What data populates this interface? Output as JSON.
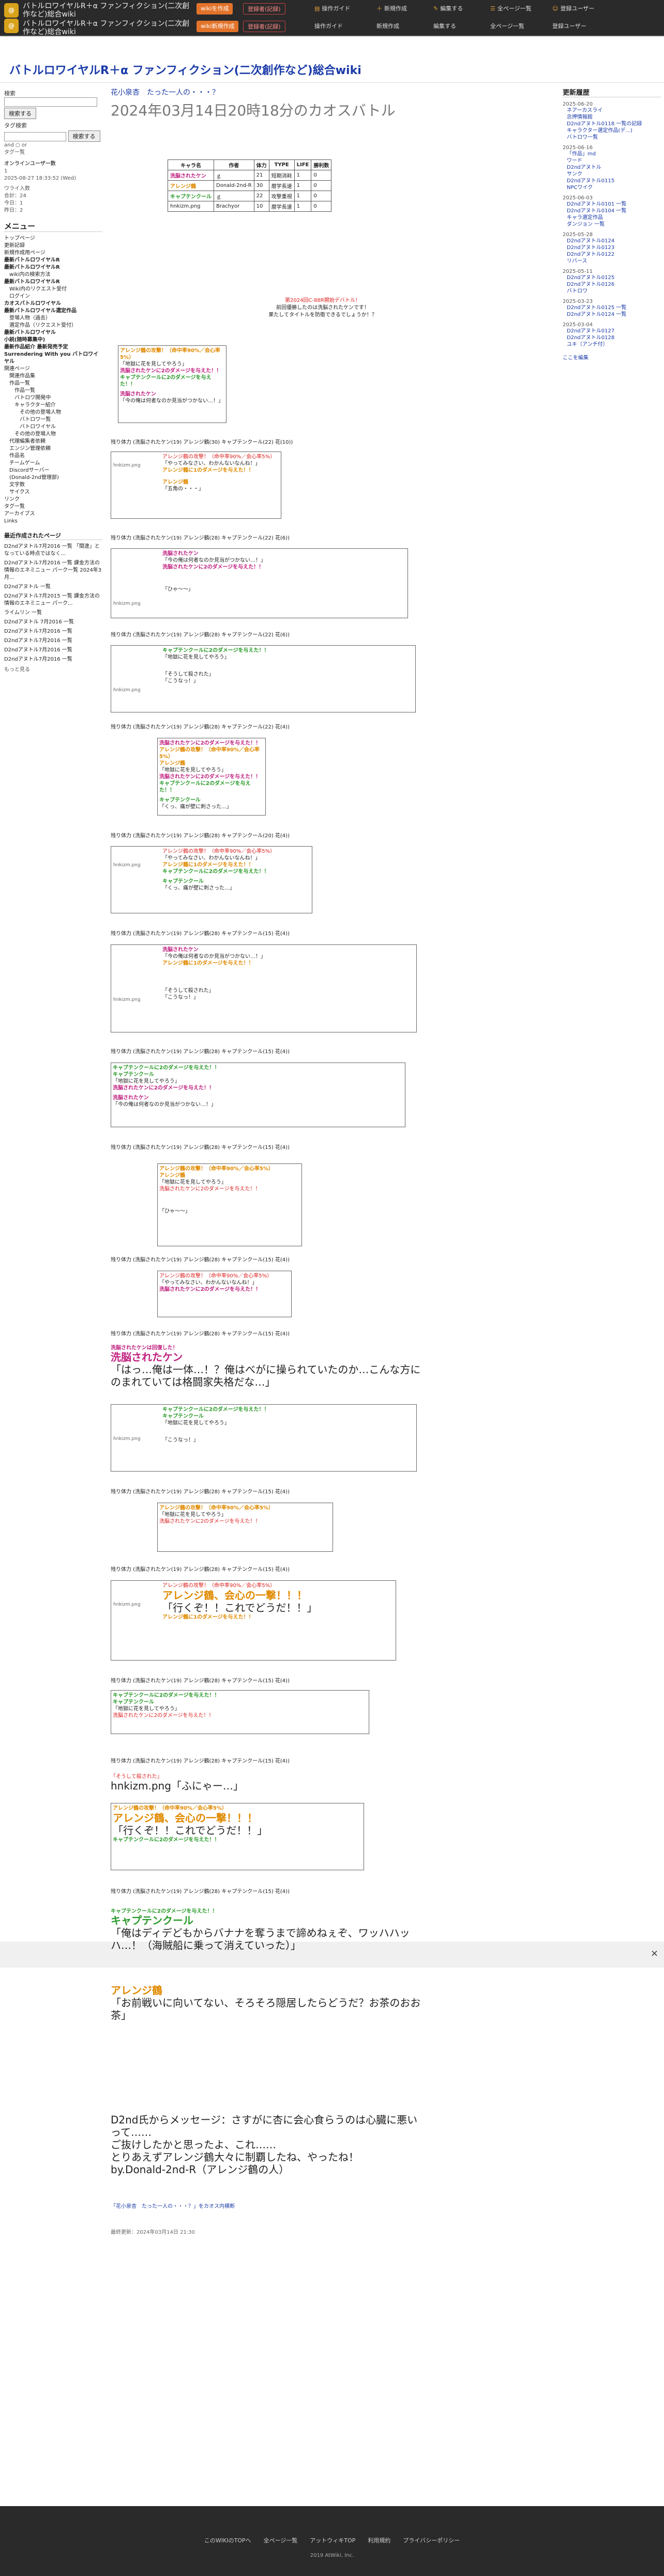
{
  "topbar": {
    "wiki_title_1": "バトルロワイヤルR＋α ファンフィクション(二次創作など)総合wiki",
    "wiki_title_2": "バトルロワイヤルR＋α ファンフィクション(二次創作など)総合wiki",
    "tabs": [
      "wikiを作成",
      "wiki新規作成",
      "登録者(記録)",
      "操作ガイド",
      "新規作成",
      "編集する",
      "全ページ一覧",
      "登録ユーザー"
    ]
  },
  "header": {
    "site_title": "バトルロワイヤルR＋α ファンフィクション(二次創作など)総合wiki"
  },
  "left": {
    "search_label": "検索",
    "search_button": "検索する",
    "tag_label": "タグ検索",
    "tag_button": "検索する",
    "and_or": "and ○ or",
    "tag_list": "タグ一覧",
    "online_title": "オンラインユーザー数",
    "online_count": "1",
    "date": "2025-08-27 18:33:52 (Wed)",
    "stats": [
      "ワライ入数",
      "合計：24",
      "今日：1",
      "昨日：2"
    ],
    "menu_title": "メニュー",
    "menu": [
      {
        "t": "トップページ",
        "c": ""
      },
      {
        "t": "更新記録",
        "c": ""
      },
      {
        "t": "新規作成用ページ",
        "c": ""
      },
      {
        "t": "最新バトルロワイヤルR",
        "c": "b"
      },
      {
        "t": "最新バトルロワイヤルR",
        "c": "b"
      },
      {
        "t": "wiki内の検索方法",
        "c": "i1"
      },
      {
        "t": "最新バトルロワイヤルR",
        "c": "b"
      },
      {
        "t": "Wiki内のリクエスト受付",
        "c": "i1"
      },
      {
        "t": "ログイン",
        "c": "i1"
      },
      {
        "t": "カオスバトルロワイヤル",
        "c": "b"
      },
      {
        "t": "最新バトルロワイヤル選定作品",
        "c": "b"
      },
      {
        "t": "登場人物（過去）",
        "c": "i1"
      },
      {
        "t": "選定作品（リクエスト受付）",
        "c": "i1"
      },
      {
        "t": "最新バトルロワイヤル",
        "c": "b"
      },
      {
        "t": "小説(随時募集中)",
        "c": "b"
      },
      {
        "t": "最新作品紹介 最新発売予定",
        "c": "b"
      },
      {
        "t": "Surrendering With you バトロワイヤル",
        "c": "b"
      },
      {
        "t": "関連ページ",
        "c": ""
      },
      {
        "t": "関連作品集",
        "c": "i1"
      },
      {
        "t": "作品一覧",
        "c": "i1"
      },
      {
        "t": "作品一覧",
        "c": "i2"
      },
      {
        "t": "バトロワ開発中",
        "c": "i2"
      },
      {
        "t": "キャラクター紹介",
        "c": "i2"
      },
      {
        "t": "その他の登場人物",
        "c": "i3"
      },
      {
        "t": "バトロワ一覧",
        "c": "i3"
      },
      {
        "t": "バトロワイヤル",
        "c": "i3"
      },
      {
        "t": "その他の登場人物",
        "c": "i2"
      },
      {
        "t": "代理編集者依頼",
        "c": "i1"
      },
      {
        "t": "エンジン管理依頼",
        "c": "i1"
      },
      {
        "t": "作品名",
        "c": "i1"
      },
      {
        "t": "チームゲーム",
        "c": "i1"
      },
      {
        "t": "Discordサーバー",
        "c": "i1"
      },
      {
        "t": "(Donald-2nd管理部)",
        "c": "i1"
      },
      {
        "t": "文字数",
        "c": "i1"
      },
      {
        "t": "サイクス",
        "c": "i1"
      },
      {
        "t": "リンク",
        "c": ""
      },
      {
        "t": "タグ一覧",
        "c": ""
      },
      {
        "t": "アーカイブス",
        "c": ""
      },
      {
        "t": "Links",
        "c": ""
      }
    ],
    "recent_title": "最近作成されたページ",
    "recent": [
      "D2ndアヌトル7月2016 一覧 「間違」となっている時点ではなく...",
      "D2ndアヌトル7月2016 一覧 課金方法の情報のエネミニュー パーク一覧 2024年3月...",
      "D2ndアヌトル 一覧",
      "D2ndアヌトル7月2015 一覧 課金方法の情報のエネミニュー パーク...",
      "ライムリン 一覧",
      "D2ndアヌトル 7月2016 一覧",
      "D2ndアヌトル7月2016 一覧",
      "D2ndアヌトル7月2016 一覧",
      "D2ndアヌトル7月2016 一覧",
      "D2ndアヌトル7月2016 一覧"
    ],
    "more": "もっと見る"
  },
  "right": {
    "title": "更新履歴",
    "groups": [
      {
        "day": "2025-06-20",
        "items": [
          "ネアーカスライ",
          "念押情報館",
          "D2ndアヌトル0118 一覧の記録",
          "キャラクター選定作品(デ...)",
          "バトロワ一覧"
        ]
      },
      {
        "day": "2025-06-16",
        "items": [
          "「作品」md",
          "ワード",
          "D2ndアヌトル",
          "サンク",
          "D2ndアヌトル0115",
          "NPCワイク"
        ]
      },
      {
        "day": "2025-06-03",
        "items": [
          "D2ndアヌトル0101 一覧",
          "D2ndアヌトル0104 一覧",
          "キャラ選定作品",
          "ダンジョン 一覧"
        ]
      },
      {
        "day": "2025-05-28",
        "items": [
          "D2ndアヌトル0124",
          "D2ndアヌトル0123",
          "D2ndアヌトル0122",
          "リバース"
        ]
      },
      {
        "day": "2025-05-11",
        "items": [
          "D2ndアヌトル0125",
          "D2ndアヌトル0126",
          "バトロワ"
        ]
      },
      {
        "day": "2025-03-23",
        "items": [
          "D2ndアヌトル0125 一覧",
          "D2ndアヌトル0124 一覧"
        ]
      },
      {
        "day": "2025-03-04",
        "items": [
          "D2ndアヌトル0127",
          "D2ndアヌトル0128",
          "ユキ（アンチ付）"
        ]
      }
    ],
    "more": "ここを編集"
  },
  "main": {
    "breadcrumb": "花小泉杏　たった一人の・・・？",
    "title": "2024年03月14日20時18分のカオスバトル",
    "status_table": {
      "headers": [
        "キャラ名",
        "作者",
        "体力",
        "TYPE",
        "LIFE",
        "勝利数"
      ],
      "rows": [
        [
          "洗脳されたケン",
          "ｇ",
          "21",
          "短期消耗",
          "1",
          "0"
        ],
        [
          "アレンジ鶴",
          "Donald-2nd-R",
          "30",
          "暦学長速",
          "1",
          "0"
        ],
        [
          "キャプテンクール",
          "ｇ",
          "22",
          "攻撃重視",
          "1",
          "0"
        ],
        [
          "hnkizm.png",
          "Brachyor",
          "10",
          "暦学長速",
          "1",
          "0"
        ]
      ]
    },
    "intro": [
      "第2024回C-88R開始デバトル！",
      "前回優勝したのは洗脳されたケンです！",
      "果たしてタイトルを防衛できるでしょうか！？"
    ],
    "logs": [
      "残り体力 (洗脳されたケン(19) アレンジ鶴(30) キャプテンクール(22) 花(10))",
      "残り体力 (洗脳されたケン(19) アレンジ鶴(28) キャプテンクール(22) 花(6))",
      "残り体力 (洗脳されたケン(19) アレンジ鶴(28) キャプテンクール(22) 花(6))",
      "残り体力 (洗脳されたケン(19) アレンジ鶴(28) キャプテンクール(22) 花(4))",
      "残り体力 (洗脳されたケン(19) アレンジ鶴(28) キャプテンクール(20) 花(4))",
      "残り体力 (洗脳されたケン(19) アレンジ鶴(28) キャプテンクール(15) 花(4))",
      "残り体力 (洗脳されたケン(19) アレンジ鶴(28) キャプテンクール(15) 花(4))"
    ],
    "battle_lines": [
      "アレンジ鶴の攻撃！（命中率90%／会心率5%）",
      "「地獄に花を見してやろう」",
      "洗脳されたケンに2のダメージを与えた！！",
      "キャプテンクールに2のダメージを与えた！！",
      "「今の俺は何者なのか見当がつかない…！」",
      "「やってみなさい、わかんないなんね！」",
      "アレンジ鶴に1のダメージを与えた！！",
      "「五角の・・・」",
      "「ひゃ～～」",
      "「そうして殺された」",
      "「こうなっ！」",
      "「くっ、痛が壁に刺さった…」"
    ],
    "big_texts": [
      "洗脳されたケンは回復した！",
      "「はっ…俺は一体…！？俺はべがに操られていたのか…こんな方にのまれていては格闘家失格だな…」",
      "hnkizm.png「ふにゃー…」",
      "アレンジ鶴、会心の一撃！！！",
      "「行くぞ！！これでどうだ！！」",
      "キャプテンクール",
      "「俺はディデどもからバナナを奪うまで諦めねぇぞ、ワッハハッハ…！（海賊船に乗って消えていった）」",
      "アレンジ鶴",
      "「お前戦いに向いてない、そろそろ隠居したらどうだ？お茶のおお茶」"
    ],
    "final": [
      "D2nd氏からメッセージ：さすがに杏に会心食らうのは心臓に悪いって……",
      "ご抜けしたかと思ったよ、これ……",
      "とりあえずアレンジ鶴大々に制覇したね、やったね！",
      "by.Donald-2nd-R（アレンジ鶴の人）"
    ],
    "back_link": "「花小泉杏　たった一人の・・・？」をカオス内横断",
    "updated": "最終更新：2024年03月14日 21:30"
  },
  "footer": {
    "links": [
      "このWIKIのTOPへ",
      "全ページ一覧",
      "アットウィキTOP",
      "利用規約",
      "プライバシーポリシー"
    ],
    "copyright": "2019 AtWiki, Inc."
  }
}
